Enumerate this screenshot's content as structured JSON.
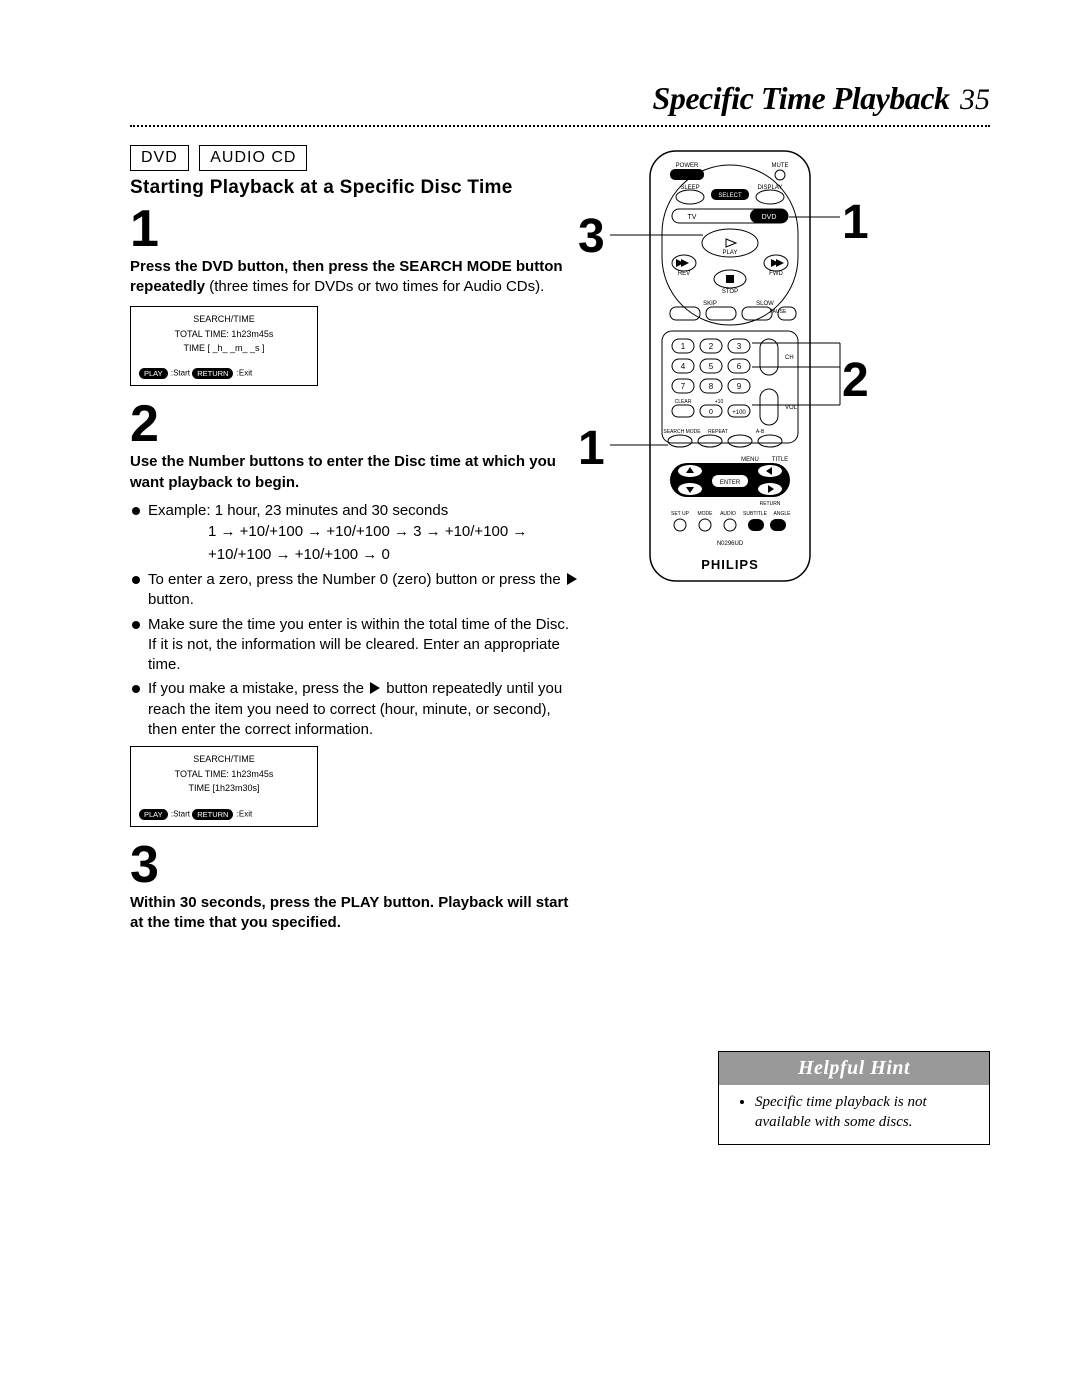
{
  "header": {
    "title": "Specific Time Playback",
    "page": "35"
  },
  "badges": {
    "dvd": "DVD",
    "audio_cd": "AUDIO CD"
  },
  "section_title": "Starting Playback at a Specific Disc Time",
  "step1": {
    "num": "1",
    "bold": "Press the DVD button, then press the SEARCH MODE button repeatedly",
    "rest": " (three times for DVDs or two times for Audio CDs)."
  },
  "osd1": {
    "title": "SEARCH/TIME",
    "total": "TOTAL  TIME:   1h23m45s",
    "time": "TIME   [ _h_ _m_ _s ]",
    "play": "PLAY",
    "start": " :Start   ",
    "return": "RETURN",
    "exit": " :Exit"
  },
  "step2": {
    "num": "2",
    "bold": "Use the Number buttons to enter the Disc time at which you want playback to begin.",
    "b1_lead": "Example: 1 hour, 23 minutes and 30 seconds",
    "ex_l1": "1  →  +10/+100  →  +10/+100  →  3  →  +10/+100  →",
    "ex_l2": "+10/+100  →  +10/+100  →  0",
    "b2a": "To enter a zero, press the Number 0 (zero) button or press the ",
    "b2b": " button.",
    "b3": "Make sure the time you enter is within the total time of the Disc. If it is not, the information will be cleared. Enter an appropriate time.",
    "b4a": "If you make a mistake, press the ",
    "b4b": " button repeatedly until you reach the item you need to correct (hour, minute, or second), then enter the correct information."
  },
  "osd2": {
    "title": "SEARCH/TIME",
    "total": "TOTAL  TIME:   1h23m45s",
    "time": "TIME   [1h23m30s]",
    "play": "PLAY",
    "start": " :Start   ",
    "return": "RETURN",
    "exit": " :Exit"
  },
  "step3": {
    "num": "3",
    "bold": "Within 30 seconds, press the PLAY button. Playback will start at the time that you specified."
  },
  "hint": {
    "title": "Helpful Hint",
    "item": "Specific time playback is not available with some discs."
  },
  "remote": {
    "brand": "PHILIPS",
    "callouts": {
      "left3": "3",
      "left1": "1",
      "right1": "1",
      "right2": "2"
    },
    "labels": {
      "power": "POWER",
      "mute": "MUTE",
      "sleep": "SLEEP",
      "select": "SELECT",
      "display": "DISPLAY",
      "tv": "TV",
      "dvd": "DVD",
      "play": "PLAY",
      "rev": "REV",
      "fwd": "FWD",
      "stop": "STOP",
      "skip": "SKIP",
      "slow": "SLOW",
      "pause": "PAUSE",
      "clear": "CLEAR",
      "plus10": "+10",
      "plus100": "+100",
      "ch": "CH",
      "vol": "VOL",
      "searchmode": "SEARCH MODE",
      "repeat": "REPEAT",
      "ab": "A-B",
      "menu": "MENU",
      "title": "TITLE",
      "enter": "ENTER",
      "return": "RETURN",
      "setup": "SET UP",
      "mode": "MODE",
      "audio": "AUDIO",
      "subtitle": "SUBTITLE",
      "angle": "ANGLE",
      "model": "N0296UD"
    }
  }
}
